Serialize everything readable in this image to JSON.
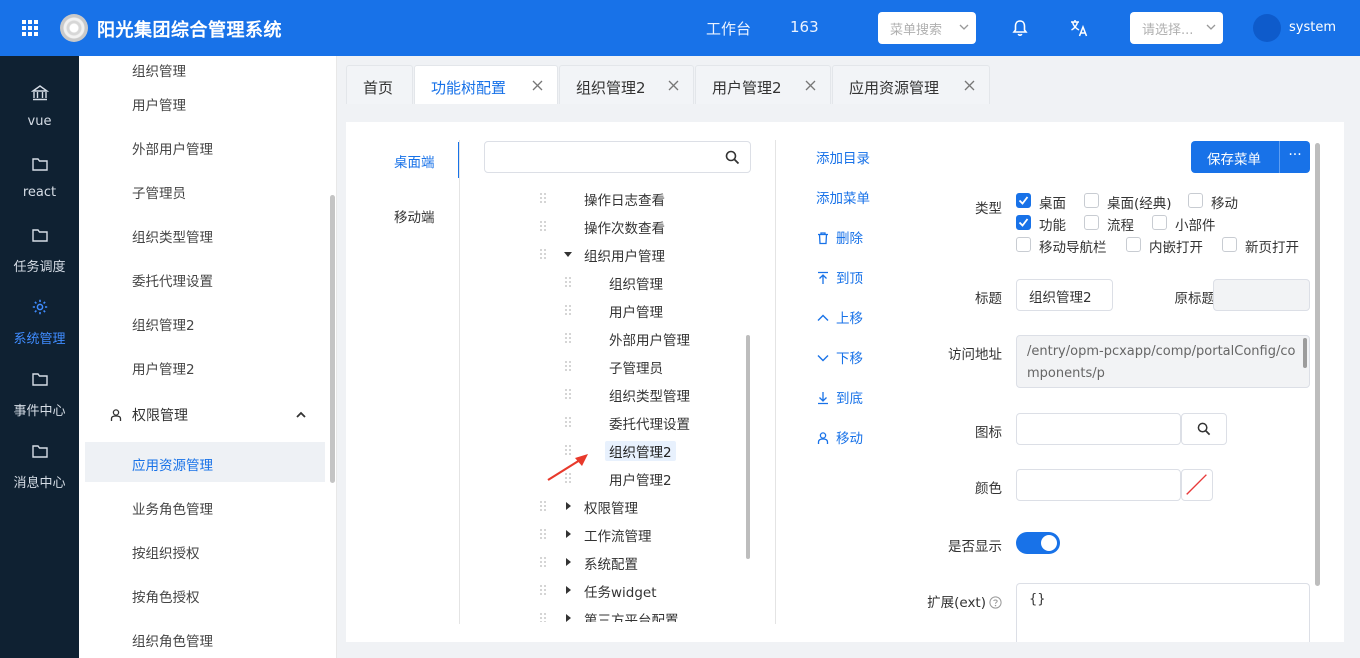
{
  "header": {
    "app_title": "阳光集团综合管理系统",
    "nav_workbench": "工作台",
    "nav_163": "163",
    "menu_search_placeholder": "菜单搜索",
    "select_placeholder": "请选择...",
    "username": "system",
    "icons": [
      "grid-icon",
      "logo",
      "bell-icon",
      "translate-icon"
    ]
  },
  "rail": {
    "items": [
      {
        "label": "vue",
        "icon": "bank-icon"
      },
      {
        "label": "react",
        "icon": "folder-icon"
      },
      {
        "label": "任务调度",
        "icon": "folder-icon"
      },
      {
        "label": "系统管理",
        "icon": "gear-icon",
        "active": true
      },
      {
        "label": "事件中心",
        "icon": "folder-icon"
      },
      {
        "label": "消息中心",
        "icon": "folder-icon"
      }
    ]
  },
  "sidebar": {
    "items_top": [
      "组织管理",
      "用户管理",
      "外部用户管理",
      "子管理员",
      "组织类型管理",
      "委托代理设置",
      "组织管理2",
      "用户管理2"
    ],
    "group": {
      "label": "权限管理"
    },
    "items_group": [
      "应用资源管理",
      "业务角色管理",
      "按组织授权",
      "按角色授权",
      "组织角色管理"
    ]
  },
  "tabs": [
    {
      "label": "首页"
    },
    {
      "label": "功能树配置",
      "active": true
    },
    {
      "label": "组织管理2"
    },
    {
      "label": "用户管理2"
    },
    {
      "label": "应用资源管理"
    }
  ],
  "platform": {
    "desktop": "桌面端",
    "mobile": "移动端"
  },
  "tree": {
    "rows": [
      {
        "label": "操作日志查看"
      },
      {
        "label": "操作次数查看"
      },
      {
        "label": "组织用户管理",
        "expanded": true
      },
      {
        "label": "组织管理"
      },
      {
        "label": "用户管理"
      },
      {
        "label": "外部用户管理"
      },
      {
        "label": "子管理员"
      },
      {
        "label": "组织类型管理"
      },
      {
        "label": "委托代理设置"
      },
      {
        "label": "组织管理2",
        "selected": true
      },
      {
        "label": "用户管理2"
      },
      {
        "label": "权限管理",
        "collapsed": true
      },
      {
        "label": "工作流管理",
        "collapsed": true
      },
      {
        "label": "系统配置",
        "collapsed": true
      },
      {
        "label": "任务widget",
        "collapsed": true
      },
      {
        "label": "第三方平台配置",
        "collapsed": true
      }
    ]
  },
  "actions": {
    "add_dir": "添加目录",
    "add_menu": "添加菜单",
    "delete": "删除",
    "to_top": "到顶",
    "move_up": "上移",
    "move_down": "下移",
    "to_bottom": "到底",
    "move": "移动"
  },
  "form": {
    "save_button": "保存菜单",
    "more_button": "···",
    "type_label": "类型",
    "types": [
      {
        "label": "桌面",
        "checked": true
      },
      {
        "label": "桌面(经典)",
        "checked": false
      },
      {
        "label": "移动",
        "checked": false
      },
      {
        "label": "功能",
        "checked": true
      },
      {
        "label": "流程",
        "checked": false
      },
      {
        "label": "小部件",
        "checked": false
      },
      {
        "label": "移动导航栏",
        "checked": false
      },
      {
        "label": "内嵌打开",
        "checked": false
      },
      {
        "label": "新页打开",
        "checked": false
      }
    ],
    "title_label": "标题",
    "title_value": "组织管理2",
    "orig_title_label": "原标题",
    "orig_title_value": "",
    "url_label": "访问地址",
    "url_value": "/entry/opm-pcxapp/comp/portalConfig/components/p",
    "icon_label": "图标",
    "color_label": "颜色",
    "show_label": "是否显示",
    "show_value": true,
    "ext_label": "扩展(ext)",
    "ext_value": "{}",
    "accent_color": "#1872e8"
  }
}
